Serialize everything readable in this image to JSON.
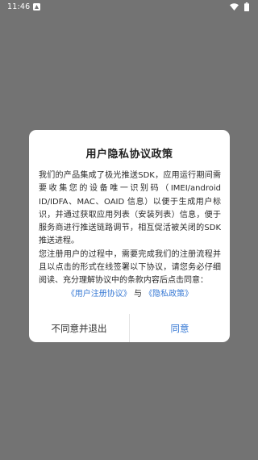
{
  "status_bar": {
    "time": "11:46",
    "icons": [
      "notification-icon",
      "wifi-icon",
      "battery-icon"
    ]
  },
  "dialog": {
    "title": "用户隐私协议政策",
    "paragraph1": "我们的产品集成了极光推送SDK，应用运行期间需要收集您的设备唯一识别码（IMEI/android ID/IDFA、MAC、OAID 信息）以便于生成用户标识，并通过获取应用列表（安装列表）信息，便于服务商进行推送链路调节，相互促活被关闭的SDK推送进程。",
    "paragraph2": "您注册用户的过程中，需要完成我们的注册流程并且以点击的形式在线签署以下协议，请您务必仔细阅读、充分理解协议中的条款内容后点击同意：",
    "link_user_agreement": "《用户注册协议》",
    "link_separator": "与",
    "link_privacy_policy": "《隐私政策》",
    "disagree_label": "不同意并退出",
    "agree_label": "同意"
  },
  "colors": {
    "overlay": "#737373",
    "accent": "#3a7bd5",
    "dialog_bg": "#ffffff"
  }
}
